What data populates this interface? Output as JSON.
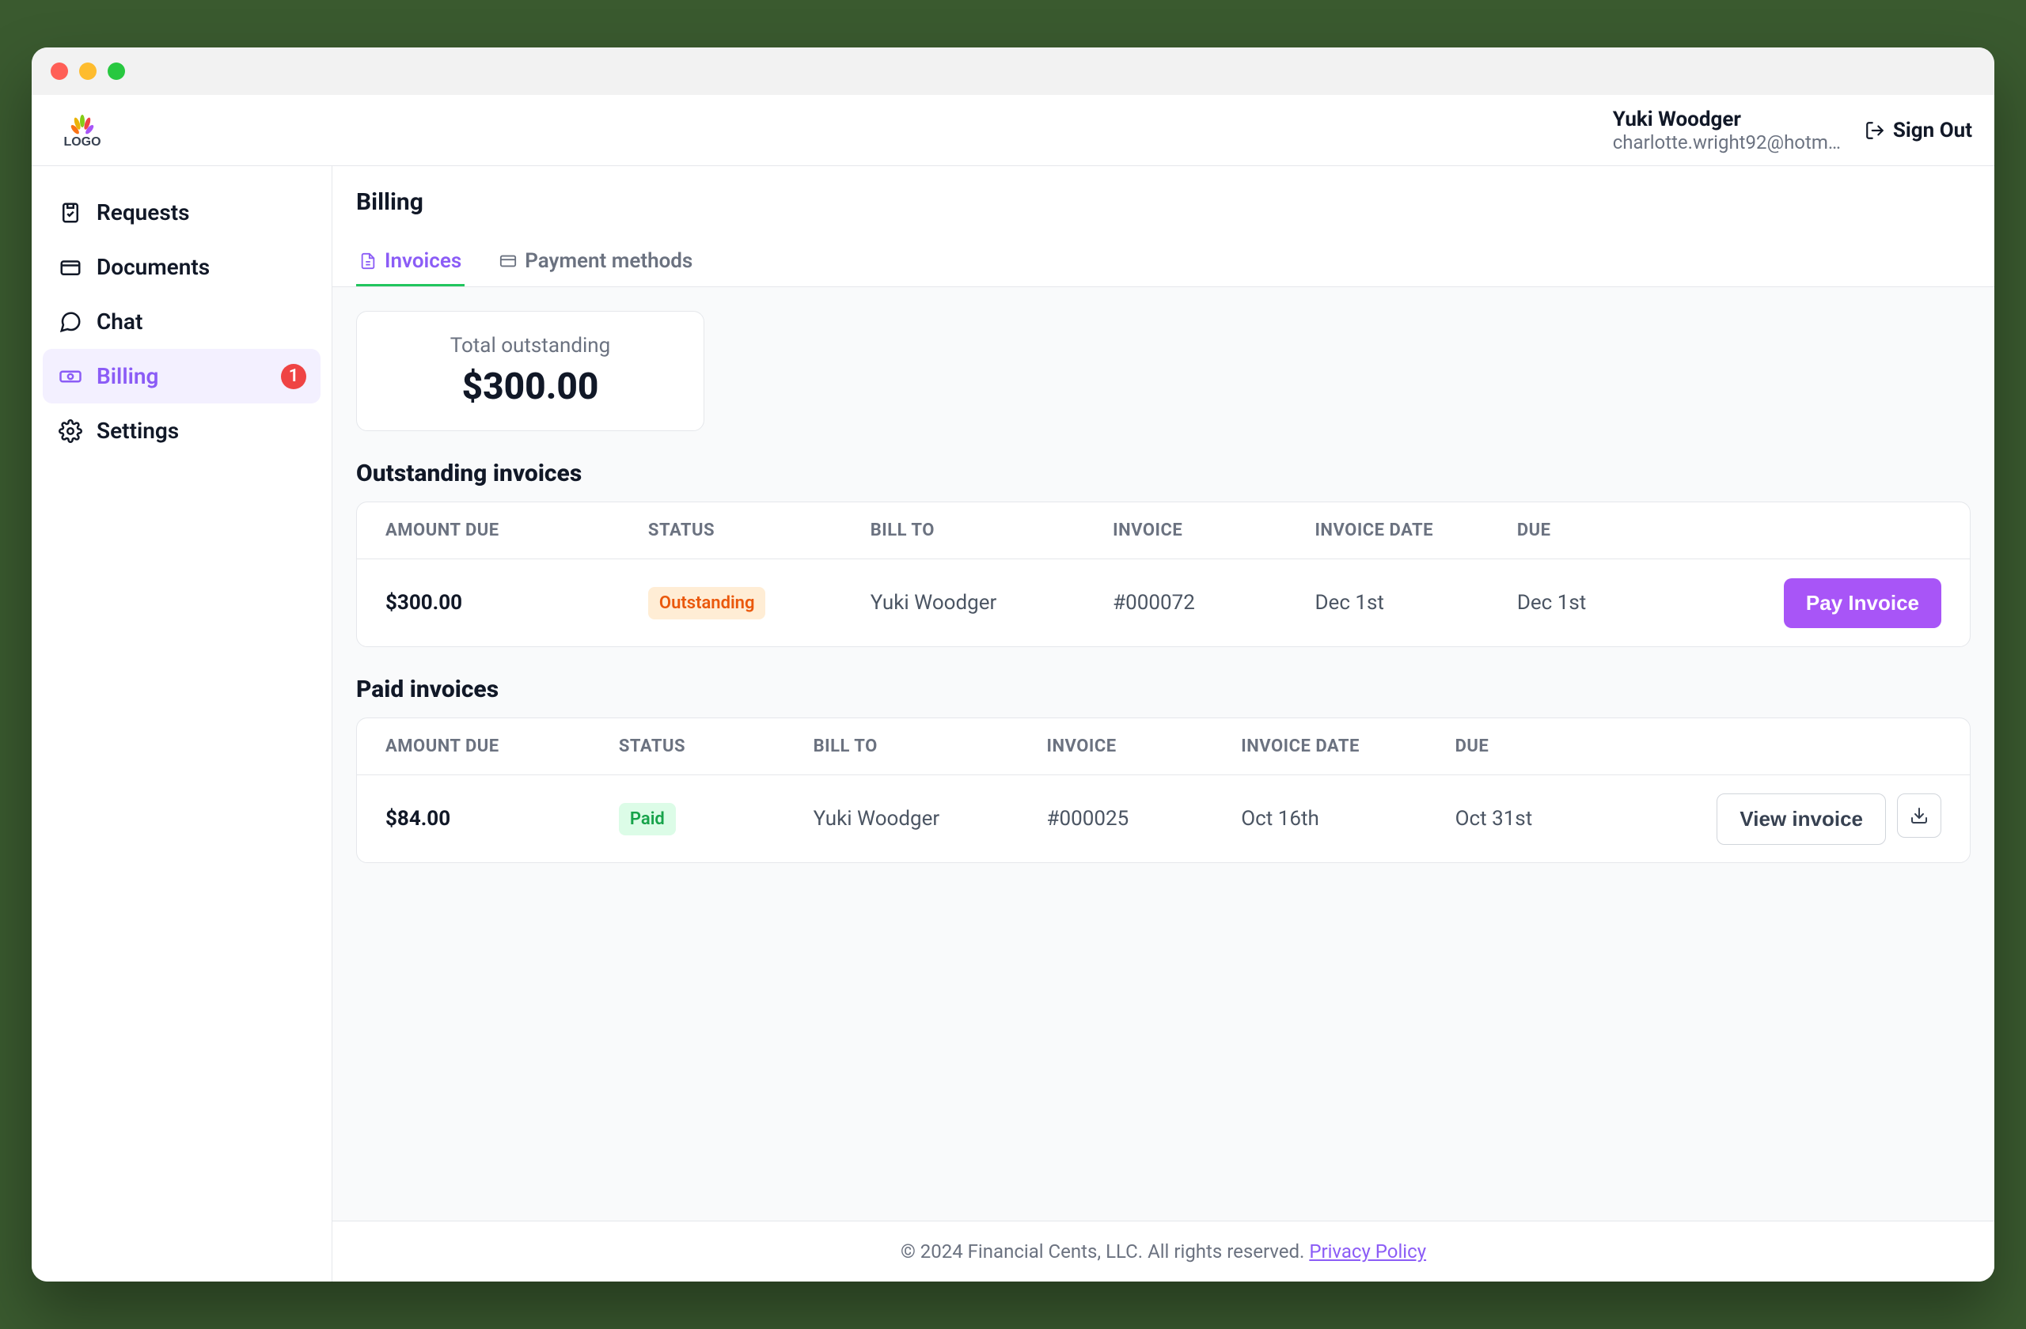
{
  "header": {
    "user_name": "Yuki Woodger",
    "user_email": "charlotte.wright92@hotm…",
    "signout_label": "Sign Out"
  },
  "sidebar": {
    "items": [
      {
        "label": "Requests"
      },
      {
        "label": "Documents"
      },
      {
        "label": "Chat"
      },
      {
        "label": "Billing",
        "badge": "1"
      },
      {
        "label": "Settings"
      }
    ]
  },
  "page": {
    "title": "Billing"
  },
  "tabs": [
    {
      "label": "Invoices"
    },
    {
      "label": "Payment methods"
    }
  ],
  "summary": {
    "label": "Total outstanding",
    "value": "$300.00"
  },
  "outstanding": {
    "title": "Outstanding invoices",
    "columns": [
      "AMOUNT DUE",
      "STATUS",
      "BILL TO",
      "INVOICE",
      "INVOICE DATE",
      "DUE"
    ],
    "rows": [
      {
        "amount": "$300.00",
        "status": "Outstanding",
        "bill_to": "Yuki Woodger",
        "invoice": "#000072",
        "invoice_date": "Dec 1st",
        "due": "Dec 1st",
        "action_label": "Pay Invoice"
      }
    ]
  },
  "paid": {
    "title": "Paid invoices",
    "columns": [
      "AMOUNT DUE",
      "STATUS",
      "BILL TO",
      "INVOICE",
      "INVOICE DATE",
      "DUE"
    ],
    "rows": [
      {
        "amount": "$84.00",
        "status": "Paid",
        "bill_to": "Yuki Woodger",
        "invoice": "#000025",
        "invoice_date": "Oct 16th",
        "due": "Oct 31st",
        "action_label": "View invoice"
      }
    ]
  },
  "footer": {
    "copyright": "© 2024 Financial Cents, LLC. All rights reserved. ",
    "privacy_label": "Privacy Policy"
  }
}
